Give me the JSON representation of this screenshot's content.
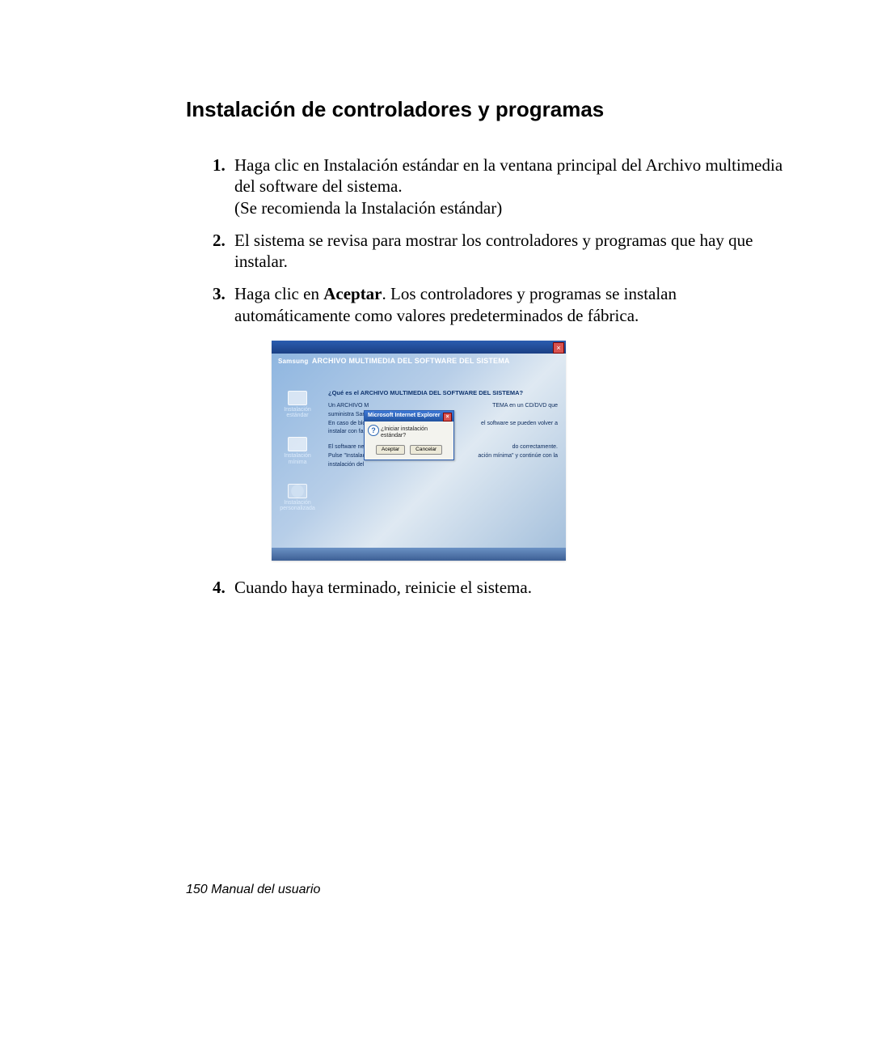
{
  "section_title": "Instalación de controladores y programas",
  "steps": {
    "s1a": "Haga clic en Instalación estándar en la ventana principal del Archivo multimedia del software del sistema.",
    "s1b": "(Se recomienda la Instalación estándar)",
    "s2": "El sistema se revisa para mostrar los controladores y programas que hay que instalar.",
    "s3_prefix": "Haga clic en ",
    "s3_bold": "Aceptar",
    "s3_suffix": ". Los controladores y programas se instalan automáticamente como valores predeterminados de fábrica.",
    "s4": "Cuando haya terminado, reinicie el sistema."
  },
  "installer": {
    "brand": "Samsung",
    "product_title": "ARCHIVO MULTIMEDIA DEL SOFTWARE DEL SISTEMA",
    "sidebar": {
      "opt1": "Instalación\nestándar",
      "opt2": "Instalación\nmínima",
      "opt3": "Instalación\npersonalizada"
    },
    "main": {
      "question": "¿Qué es el ARCHIVO MULTIMEDIA DEL SOFTWARE DEL SISTEMA?",
      "line1_left": "Un ARCHIVO M",
      "line1_right": "TEMA en un CD/DVD que",
      "line2_left": "suministra Sam",
      "line2_right": "",
      "line3_left": "En caso de blo",
      "line3_right": "el software se pueden volver a",
      "line4_left": "instalar con fac",
      "line5_left": "El software nec",
      "line5_right": "do correctamente.",
      "line6_left": "Pulse \"Instalac",
      "line6_right": "ación mínima\" y continúe con la",
      "line7_left": "instalación del"
    },
    "dialog": {
      "title": "Microsoft Internet Explorer",
      "body": "¿Iniciar instalación estándar?",
      "accept": "Aceptar",
      "cancel": "Cancelar"
    }
  },
  "footer": "150  Manual del usuario"
}
